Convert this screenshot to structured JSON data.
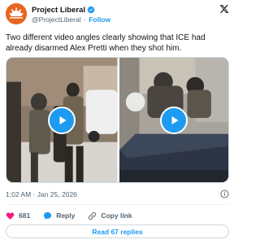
{
  "author": {
    "name": "Project Liberal",
    "handle": "@ProjectLiberal",
    "follow_label": "Follow",
    "separator": "·",
    "avatar_color": "#e8661f",
    "verified_color": "#1d9bf0"
  },
  "tweet": {
    "text": "Two different video angles clearly showing that ICE had already disarmed Alex Pretti when they shot him.",
    "timestamp": "1:02 AM · Jan 25, 2026"
  },
  "media": {
    "videos": [
      {
        "icon": "play-icon"
      },
      {
        "icon": "play-icon"
      }
    ],
    "play_color": "#1d9bf0"
  },
  "actions": {
    "like_count": "681",
    "reply_label": "Reply",
    "copy_link_label": "Copy link",
    "like_color": "#f91880"
  },
  "read_replies_label": "Read 67 replies",
  "accent": "#1d9bf0"
}
